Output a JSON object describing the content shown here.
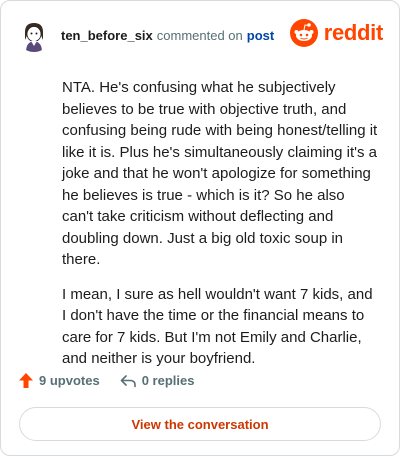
{
  "header": {
    "username": "ten_before_six",
    "action_text": "commented on",
    "link_text": "post",
    "brand_name": "reddit"
  },
  "comment": {
    "paragraphs": [
      "NTA. He's confusing what he subjectively believes to be true with objective truth, and confusing being rude with being honest/telling it like it is. Plus he's simultaneously claiming it's a joke and that he won't apologize for something he believes is true - which is it? So he also can't take criticism without deflecting and doubling down. Just a big old toxic soup in there.",
      "I mean, I sure as hell wouldn't want 7 kids, and I don't have the time or the financial means to care for 7 kids. But I'm not Emily and Charlie, and neither is your boyfriend."
    ]
  },
  "actions": {
    "upvotes": "9 upvotes",
    "replies": "0 replies"
  },
  "footer": {
    "button_label": "View the conversation"
  },
  "colors": {
    "brand": "#ff4500",
    "link": "#0045ac",
    "button_text": "#cc3700"
  },
  "icons": [
    "avatar-icon",
    "reddit-logo-icon",
    "upvote-arrow-icon",
    "reply-arrow-icon"
  ]
}
